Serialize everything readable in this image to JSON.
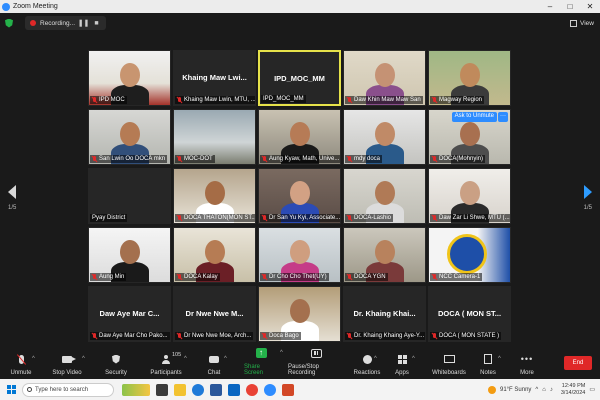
{
  "window": {
    "title": "Zoom Meeting"
  },
  "topbar": {
    "recording_label": "Recording...",
    "view_label": "View"
  },
  "pager": {
    "left": "1/5",
    "right": "1/5"
  },
  "tiles": [
    {
      "center": "",
      "label": "IPD MOC",
      "muted": true,
      "scene": "person1"
    },
    {
      "center": "Khaing Maw Lwi...",
      "label": "Khaing Maw Lwin, MTU, ...",
      "muted": true,
      "scene": "dark"
    },
    {
      "center": "IPD_MOC_MM",
      "label": "IPD_MOC_MM",
      "muted": false,
      "scene": "dark",
      "active": true
    },
    {
      "center": "",
      "label": "Daw Khin Maw Maw San",
      "muted": true,
      "scene": "person2"
    },
    {
      "center": "",
      "label": "Magway Region",
      "muted": true,
      "scene": "person3"
    },
    {
      "center": "",
      "label": "San Lwin Oo DOCA mkn",
      "muted": true,
      "scene": "person4"
    },
    {
      "center": "",
      "label": "MOC-DOT",
      "muted": true,
      "scene": "office"
    },
    {
      "center": "",
      "label": "Aung Kyaw, Math, Unive...",
      "muted": true,
      "scene": "shelf"
    },
    {
      "center": "",
      "label": "mdy doca",
      "muted": true,
      "scene": "person5"
    },
    {
      "center": "",
      "label": "DOCA(Mohnyin)",
      "muted": true,
      "scene": "room",
      "unmute": "Ask to Unmute",
      "more": "···"
    },
    {
      "center": "",
      "label": "Pyay District",
      "muted": false,
      "scene": "dark"
    },
    {
      "center": "",
      "label": "DOCA THATON(MON ST...",
      "muted": true,
      "scene": "person6"
    },
    {
      "center": "",
      "label": "Dr San Yu Kyi, Associate...",
      "muted": true,
      "scene": "person7"
    },
    {
      "center": "",
      "label": "DOCA-Lashio",
      "muted": true,
      "scene": "person8"
    },
    {
      "center": "",
      "label": "Daw Zar Li Shwe, MTU (...",
      "muted": true,
      "scene": "person9"
    },
    {
      "center": "",
      "label": "Aung Min",
      "muted": true,
      "scene": "person10"
    },
    {
      "center": "",
      "label": "DOCA Kalay",
      "muted": true,
      "scene": "person11"
    },
    {
      "center": "",
      "label": "Dr Cho Cho Thet(UY)",
      "muted": true,
      "scene": "person12"
    },
    {
      "center": "",
      "label": "DOCA YGN",
      "muted": true,
      "scene": "person13"
    },
    {
      "center": "",
      "label": "NCC Camera-1",
      "muted": true,
      "scene": "logo"
    },
    {
      "center": "Daw Aye  Mar C...",
      "label": "Daw Aye  Mar Cho Pako...",
      "muted": true,
      "scene": "dark"
    },
    {
      "center": "Dr Nwe Nwe M...",
      "label": "Dr Nwe Nwe Moe, Arch...",
      "muted": true,
      "scene": "dark"
    },
    {
      "center": "",
      "label": "Doca Bago",
      "muted": true,
      "scene": "person14"
    },
    {
      "center": "Dr. Khaing Khai...",
      "label": "Dr. Khaing Khaing Aye-Y...",
      "muted": true,
      "scene": "dark"
    },
    {
      "center": "DOCA ( MON ST...",
      "label": "DOCA ( MON STATE )",
      "muted": true,
      "scene": "dark"
    }
  ],
  "toolbar": {
    "unmute": "Unmute",
    "stop_video": "Stop Video",
    "security": "Security",
    "participants": "Participants",
    "participants_count": "105",
    "chat": "Chat",
    "share_screen": "Share Screen",
    "pause_stop_recording": "Pause/Stop Recording",
    "reactions": "Reactions",
    "apps": "Apps",
    "whiteboards": "Whiteboards",
    "notes": "Notes",
    "more": "More",
    "end": "End"
  },
  "taskbar": {
    "search_placeholder": "Type here to search",
    "weather": "91°F  Sunny",
    "time": "12:49 PM",
    "date": "3/14/2024"
  },
  "colors": {
    "accent": "#2d8cff",
    "active_speaker": "#e6e24a",
    "end": "#e02828",
    "share": "#24b24a"
  }
}
